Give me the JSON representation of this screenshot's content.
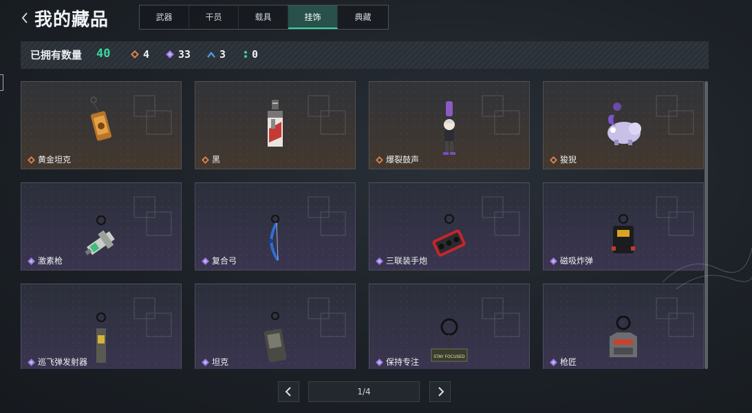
{
  "header": {
    "title": "我的藏品"
  },
  "tabs": [
    {
      "label": "武器"
    },
    {
      "label": "干员"
    },
    {
      "label": "载具"
    },
    {
      "label": "挂饰",
      "active": true
    },
    {
      "label": "典藏"
    }
  ],
  "stats": {
    "owned_label": "已拥有数量",
    "owned_total": "40",
    "rarities": [
      {
        "icon": "orange-diamond-icon",
        "color": "#d9824a",
        "count": "4"
      },
      {
        "icon": "purple-diamond-icon",
        "color": "#9a78e0",
        "count": "33"
      },
      {
        "icon": "blue-chevron-icon",
        "color": "#4a9be0",
        "count": "3"
      },
      {
        "icon": "green-dots-icon",
        "color": "#3bd3a0",
        "count": "0"
      }
    ]
  },
  "items": [
    {
      "name": "黄金坦克",
      "rarity": "orange",
      "icon": "golden-tank-charm"
    },
    {
      "name": "黑",
      "rarity": "orange",
      "icon": "black-tag-charm"
    },
    {
      "name": "爆裂鼓声",
      "rarity": "orange",
      "icon": "drum-figure-charm"
    },
    {
      "name": "狻猊",
      "rarity": "orange",
      "icon": "lion-beast-charm"
    },
    {
      "name": "激素枪",
      "rarity": "purple",
      "icon": "hormone-gun-charm"
    },
    {
      "name": "复合弓",
      "rarity": "purple",
      "icon": "compound-bow-charm"
    },
    {
      "name": "三联装手炮",
      "rarity": "purple",
      "icon": "hand-cannon-charm"
    },
    {
      "name": "磁吸炸弹",
      "rarity": "purple",
      "icon": "magnetic-bomb-charm"
    },
    {
      "name": "巡飞弹发射器",
      "rarity": "purple",
      "icon": "loitering-launcher-charm"
    },
    {
      "name": "坦克",
      "rarity": "purple",
      "icon": "tank-charm"
    },
    {
      "name": "保持专注",
      "rarity": "purple",
      "icon": "stay-focused-charm",
      "caption": "STAY FOCUSED"
    },
    {
      "name": "枪匠",
      "rarity": "purple",
      "icon": "gunsmith-charm"
    }
  ],
  "pagination": {
    "page": "1/4"
  },
  "colors": {
    "accent": "#37d6a6",
    "orange": "#d9824a",
    "purple": "#9a78e0"
  }
}
